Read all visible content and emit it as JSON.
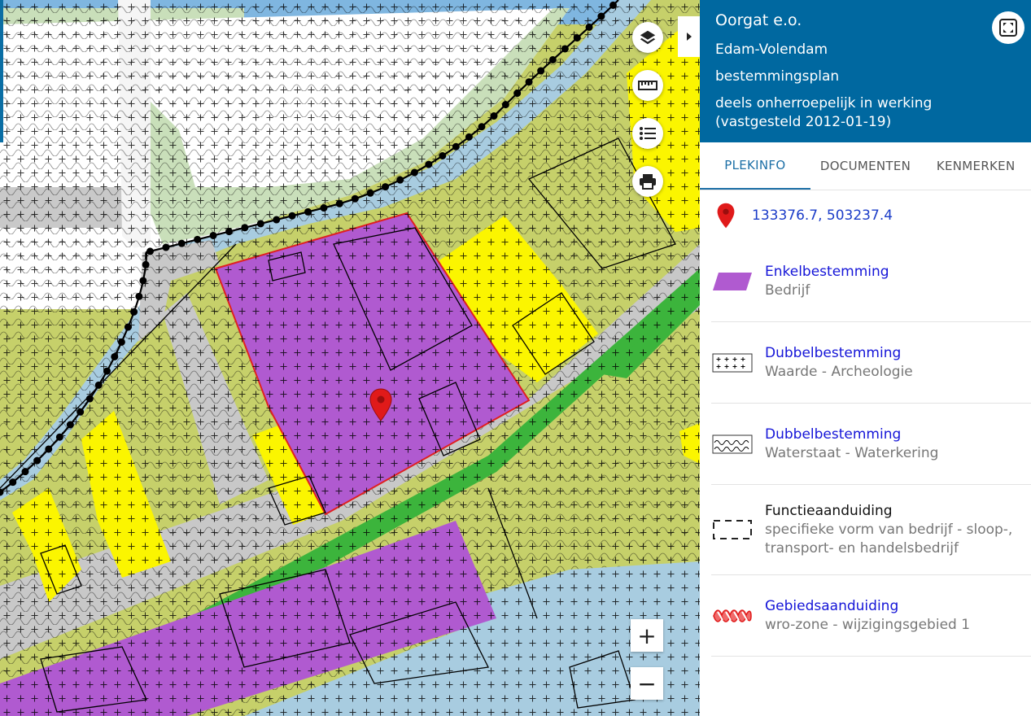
{
  "header": {
    "title": "Oorgat e.o.",
    "municipality": "Edam-Volendam",
    "plan_type": "bestemmingsplan",
    "status": "deels onherroepelijk in werking (vastgesteld 2012-01-19)"
  },
  "tabs": [
    {
      "label": "PLEKINFO",
      "active": true
    },
    {
      "label": "DOCUMENTEN",
      "active": false
    },
    {
      "label": "KENMERKEN",
      "active": false
    }
  ],
  "location": {
    "coordinates": "133376.7, 503237.4"
  },
  "legend_items": [
    {
      "title": "Enkelbestemming",
      "subtitle": "Bedrijf",
      "symbol": "purple-parallelogram"
    },
    {
      "title": "Dubbelbestemming",
      "subtitle": "Waarde - Archeologie",
      "symbol": "plus-pattern"
    },
    {
      "title": "Dubbelbestemming",
      "subtitle": "Waterstaat - Waterkering",
      "symbol": "wave-pattern"
    },
    {
      "title": "Functieaanduiding",
      "subtitle": "specifieke vorm van bedrijf - sloop-, transport- en handelsbedrijf",
      "symbol": "dashed-rectangle"
    },
    {
      "title": "Gebiedsaanduiding",
      "subtitle": "wro-zone - wijzigingsgebied 1",
      "symbol": "red-zigzag-zone"
    }
  ],
  "map_controls": {
    "zoom_in": "+",
    "zoom_out": "−"
  },
  "colors": {
    "header_blue": "#0068a0",
    "bedrijf_purple": "#b05ad0",
    "agrarisch_green": "#c6d06a",
    "wonen_yellow": "#fbf500",
    "water_blue": "#a8cce0",
    "verkeer_grey": "#c8c8c8",
    "groen": "#3cb43c",
    "link_blue": "#1515d8",
    "marker_red": "#e01a1a"
  }
}
